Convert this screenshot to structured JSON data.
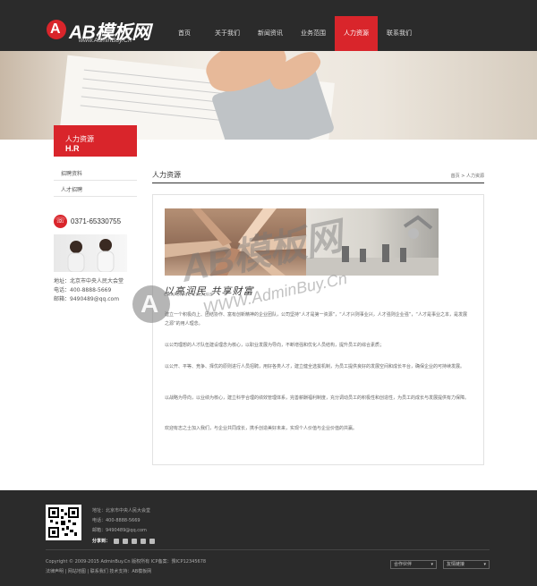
{
  "brand": {
    "logo_letter": "A",
    "name": "AB模板网",
    "url": "www.AdminBuy.Cn"
  },
  "nav": [
    "首页",
    "关于我们",
    "新闻资讯",
    "业务范围",
    "人力资源",
    "联系我们"
  ],
  "nav_active_index": 4,
  "sidebar": {
    "title_cn": "人力资源",
    "title_en": "H.R",
    "links": [
      "招聘资料",
      "人才招聘"
    ],
    "phone": "0371-65330755",
    "address": "地址：北京市中央人民大会堂",
    "tel": "电话：400-8888-5669",
    "email": "邮箱：9490489@qq.com"
  },
  "main": {
    "title": "人力资源",
    "breadcrumb": "首页 > 人力资源",
    "slogan": "以高润民  共享财富",
    "slogan_en": "CORPORATE CULTURE",
    "paragraphs": [
      "建立一个积极向上、团结协作、富有创新精神的企业团队，公司坚持“人才是第一资源”，“人才兴则事业兴，人才强则企业强”，“人才是事业之本，是发展之源”的用人理念。",
      "以公司理想的人才队伍建设理念为核心，以职业发展为导向，不断增强和优化人员结构，提升员工的综合素质；",
      "以公开、平等、竞争、择优的原则进行人员招聘，用好各类人才，建立健全选拔机制，为员工提供良好的发展空间和成长平台，确保企业的可持续发展。",
      "以战略为导向，以业绩为核心，建立科学合理的绩效管理体系，完善薪酬福利制度，充分调动员工的积极性和创造性，为员工的成长与发展提供有力保障。",
      "欢迎有志之士加入我们，与企业共同成长，携手创造美好未来，实现个人价值与企业价值的共赢。"
    ]
  },
  "watermark": {
    "letter": "A",
    "text": "AB模板网",
    "sub": "WWW.AdminBuy.Cn"
  },
  "footer": {
    "address": "地址：北京市中央人民大会堂",
    "tel": "电话：400-8888-5669",
    "email": "邮箱：9490489@qq.com",
    "share_label": "分享到：",
    "copyright": "Copyright © 2009-2015 AdminBuy.Cn 版权所有   ICP备案：豫ICP12345678",
    "links": "法律声明 | 网站地图 | 联系我们     技术支持：AB模板网",
    "select1": "合作伙伴",
    "select2": "友情链接"
  },
  "colors": {
    "accent": "#d9252b",
    "dark": "#2b2b2b"
  }
}
